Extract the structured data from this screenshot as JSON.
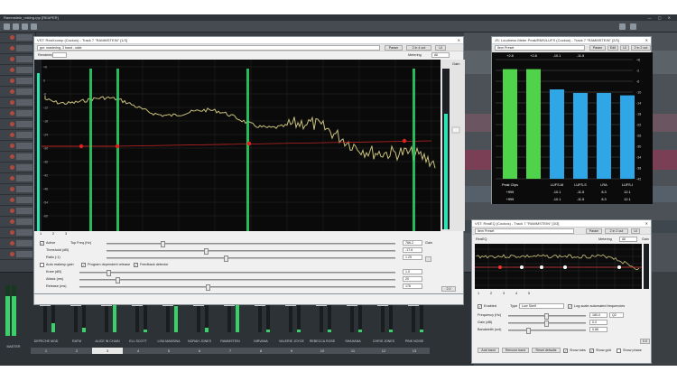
{
  "app": {
    "title": "Rammstein_mixing.rpp [REAPER]",
    "window_controls": "— ▢ ✕"
  },
  "mixer": {
    "master_label": "MASTER",
    "strips": [
      {
        "name": "DEPECHE MOD",
        "num": "1",
        "level": 0.2,
        "fader": 0.35
      },
      {
        "name": "RATM",
        "num": "2",
        "level": 0.1,
        "fader": 0.35
      },
      {
        "name": "ALICE IN CHAIN",
        "num": "3",
        "level": 0.6,
        "fader": 0.35,
        "selected": true
      },
      {
        "name": "ELL SCOTT",
        "num": "4",
        "level": 0.05,
        "fader": 0.35
      },
      {
        "name": "LISA MANSINA",
        "num": "5",
        "level": 0.55,
        "fader": 0.35
      },
      {
        "name": "NORAH JONES",
        "num": "6",
        "level": 0.1,
        "fader": 0.35
      },
      {
        "name": "RAMMSTEIN",
        "num": "7",
        "level": 0.6,
        "fader": 0.35
      },
      {
        "name": "NIRVANA",
        "num": "8",
        "level": 0.05,
        "fader": 0.35
      },
      {
        "name": "VALERIE JOYCE",
        "num": "9",
        "level": 0.05,
        "fader": 0.35
      },
      {
        "name": "REBECCA ROSE",
        "num": "10",
        "level": 0.05,
        "fader": 0.35
      },
      {
        "name": "SHAHANA",
        "num": "11",
        "level": 0.05,
        "fader": 0.35
      },
      {
        "name": "CHRIS JONES",
        "num": "12",
        "level": 0.05,
        "fader": 0.35
      },
      {
        "name": "PINK NOISE",
        "num": "13",
        "level": 0.05,
        "fader": 0.35
      }
    ],
    "master_values": [
      "-4.4",
      "-1.7"
    ]
  },
  "realcomp": {
    "title": "VST: ReaXcomp (Cockos) - Track 7 \"RAMMSTEIN\" [1/3]",
    "preset": "gnr: mastering, 3 band - wide",
    "param_btn": "Param",
    "io_btn": "2 in 4 out",
    "ui_btn": "UI",
    "rendering_label": "Rendering",
    "metering_label": "Metering",
    "metering_value": "All",
    "gain_label": "Gain",
    "db_scale": [
      "+6",
      "0",
      "-6",
      "-12",
      "-18",
      "-24",
      "-30",
      "-36",
      "-42",
      "-48",
      "-54",
      "-60"
    ],
    "band_tabs": [
      "1",
      "2",
      "3"
    ],
    "active_label": "Active",
    "topfreq_label": "Top Freq (Hz)",
    "topfreq_value": "766.2",
    "threshold_label": "Threshold (dB)",
    "threshold_value": "-17.6",
    "ratio_label": "Ratio (:1)",
    "ratio_value": "1.25",
    "automakeup_label": "Auto makeup gain",
    "progdep_label": "Program dependent release",
    "feedback_label": "Feedback detector",
    "knee_label": "Knee (dB)",
    "knee_value": "1.0",
    "attack_label": "Attack (ms)",
    "attack_value": "20",
    "release_label": "Release (ms)",
    "release_value": "176",
    "rms_label": "RMS size (ms)",
    "rms_value": "0",
    "rms_value2": "0.0",
    "logscale_label": "Log scale automated frequencies",
    "addband_btn": "Add band",
    "deleteband_btn": "Delete band",
    "reset_btn": "Reset to defaults",
    "solo_label": "Solo current band",
    "tabs_label": "Tabs",
    "grid_label": "Grid",
    "side_value": "2.0",
    "gain_value": "Gain"
  },
  "loudness": {
    "title": "JS: Loudness Meter Peak/RMS/LUFS (Cockos) - Track 7 \"RAMMSTEIN\" [2/3]",
    "preset": "Item Preset",
    "param_btn": "Param",
    "edit_btn": "Edit",
    "ui_btn": "UI",
    "io_btn": "2 in 2 out",
    "top_values": [
      "+2.8",
      "+2.8",
      "-10.1",
      "-11.5"
    ],
    "scale": [
      "+6",
      "-2",
      "-6",
      "-10",
      "-14",
      "-18",
      "-22",
      "-26",
      "-30",
      "-34",
      "-38",
      "-42"
    ],
    "bars": [
      {
        "label": "Peak Clips",
        "value_a": "+999",
        "value_b": "+999",
        "level": 0.92,
        "color": "#4fd34a"
      },
      {
        "label": "",
        "value_a": "",
        "value_b": "",
        "level": 0.92,
        "color": "#4fd34a"
      },
      {
        "label": "LUFS-M",
        "value_a": "-10.1",
        "value_b": "-10.1",
        "level": 0.75,
        "color": "#2fa6e6"
      },
      {
        "label": "LUFS-S",
        "value_a": "-11.5",
        "value_b": "-11.5",
        "level": 0.72,
        "color": "#2fa6e6"
      },
      {
        "label": "LRA",
        "value_a": "8.3",
        "value_b": "8.3",
        "level": 0.72,
        "color": "#2fa6e6"
      },
      {
        "label": "LUFS-I",
        "value_a": "12.1",
        "value_b": "12.1",
        "level": 0.7,
        "color": "#2fa6e6"
      }
    ]
  },
  "reaeq": {
    "title": "VST: ReaEQ (Cockos) - Track 7 \"RAMMSTEIN\" [3/3]",
    "preset": "Item Preset",
    "param_btn": "Param",
    "io_btn": "2 in 2 out",
    "ui_btn": "UI",
    "reaeq_label": "ReaEQ",
    "metering_label": "Metering",
    "metering_value": "All",
    "gain_label": "Gain",
    "band_tabs": [
      "1",
      "2",
      "3",
      "4",
      "5"
    ],
    "enabled_label": "Enabled",
    "type_label": "Type",
    "type_value": "Low Shelf",
    "logscale_label": "Log-scale automated frequencies",
    "freq_label": "Frequency (Hz)",
    "freq_value": "180.0",
    "freq_value2": "Q2",
    "gain_db_label": "Gain (dB)",
    "gain_db_value": "0.0",
    "bandwidth_label": "Bandwidth (oct)",
    "bandwidth_value": "0.86",
    "addband_btn": "Add band",
    "removeband_btn": "Remove band",
    "reset_btn": "Reset defaults",
    "showtabs_label": "Show tabs",
    "showgrid_label": "Show grid",
    "showphase_label": "Show phase",
    "side_value": "0.0"
  }
}
